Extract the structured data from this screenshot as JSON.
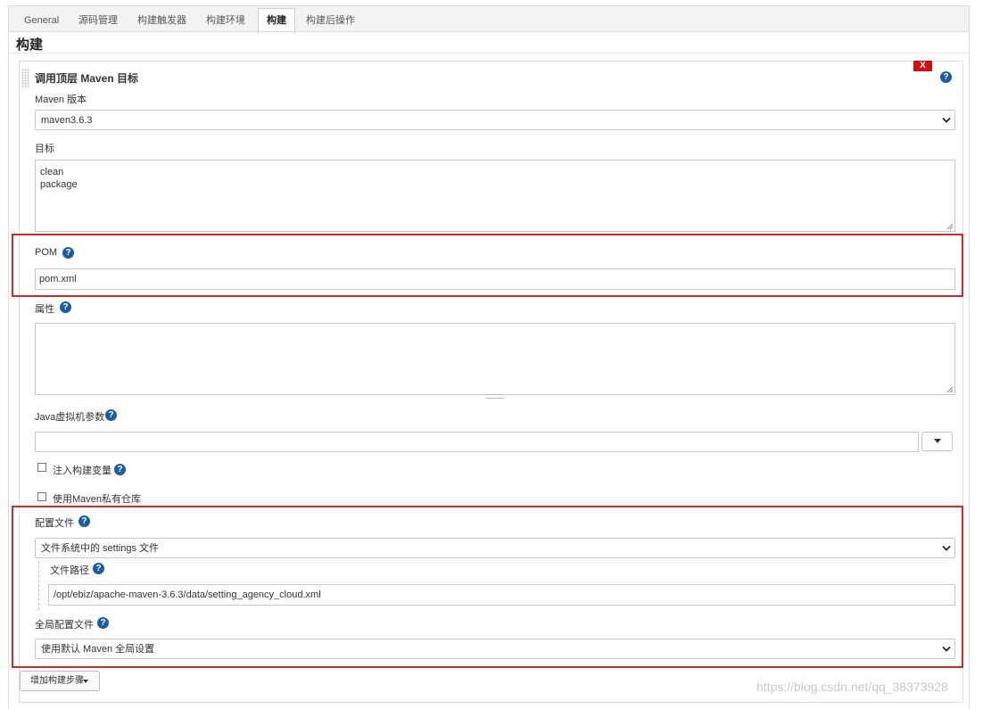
{
  "tabs": [
    {
      "label": "General",
      "active": false
    },
    {
      "label": "源码管理",
      "active": false
    },
    {
      "label": "构建触发器",
      "active": false
    },
    {
      "label": "构建环境",
      "active": false
    },
    {
      "label": "构建",
      "active": true
    },
    {
      "label": "构建后操作",
      "active": false
    }
  ],
  "section_title": "构建",
  "step": {
    "title": "调用顶层 Maven 目标",
    "delete_label": "X",
    "help_glyph": "?"
  },
  "maven_version": {
    "label": "Maven 版本",
    "value": "maven3.6.3"
  },
  "goals": {
    "label": "目标",
    "lines": [
      "clean",
      "package"
    ]
  },
  "pom": {
    "label": "POM",
    "value": "pom.xml"
  },
  "properties": {
    "label": "属性",
    "value": ""
  },
  "jvm_options": {
    "label": "Java虚拟机参数",
    "value": ""
  },
  "inject_env": {
    "label": "注入构建变量",
    "checked": false
  },
  "private_repo": {
    "label": "使用Maven私有仓库",
    "checked": false
  },
  "settings": {
    "label": "配置文件",
    "value": "文件系统中的 settings 文件",
    "path_label": "文件路径",
    "path_value": "/opt/ebiz/apache-maven-3.6.3/data/setting_agency_cloud.xml"
  },
  "global_settings": {
    "label": "全局配置文件",
    "value": "使用默认 Maven 全局设置"
  },
  "add_step_label": "增加构建步骤",
  "watermark": "https://blog.csdn.net/qq_38373928",
  "colors": {
    "highlight": "#d9272e",
    "help": "#1a5da6",
    "delete": "#d20f0f"
  },
  "icons": [
    "help-icon",
    "chevron-down-icon",
    "drag-handle-icon",
    "caret-down-icon"
  ]
}
